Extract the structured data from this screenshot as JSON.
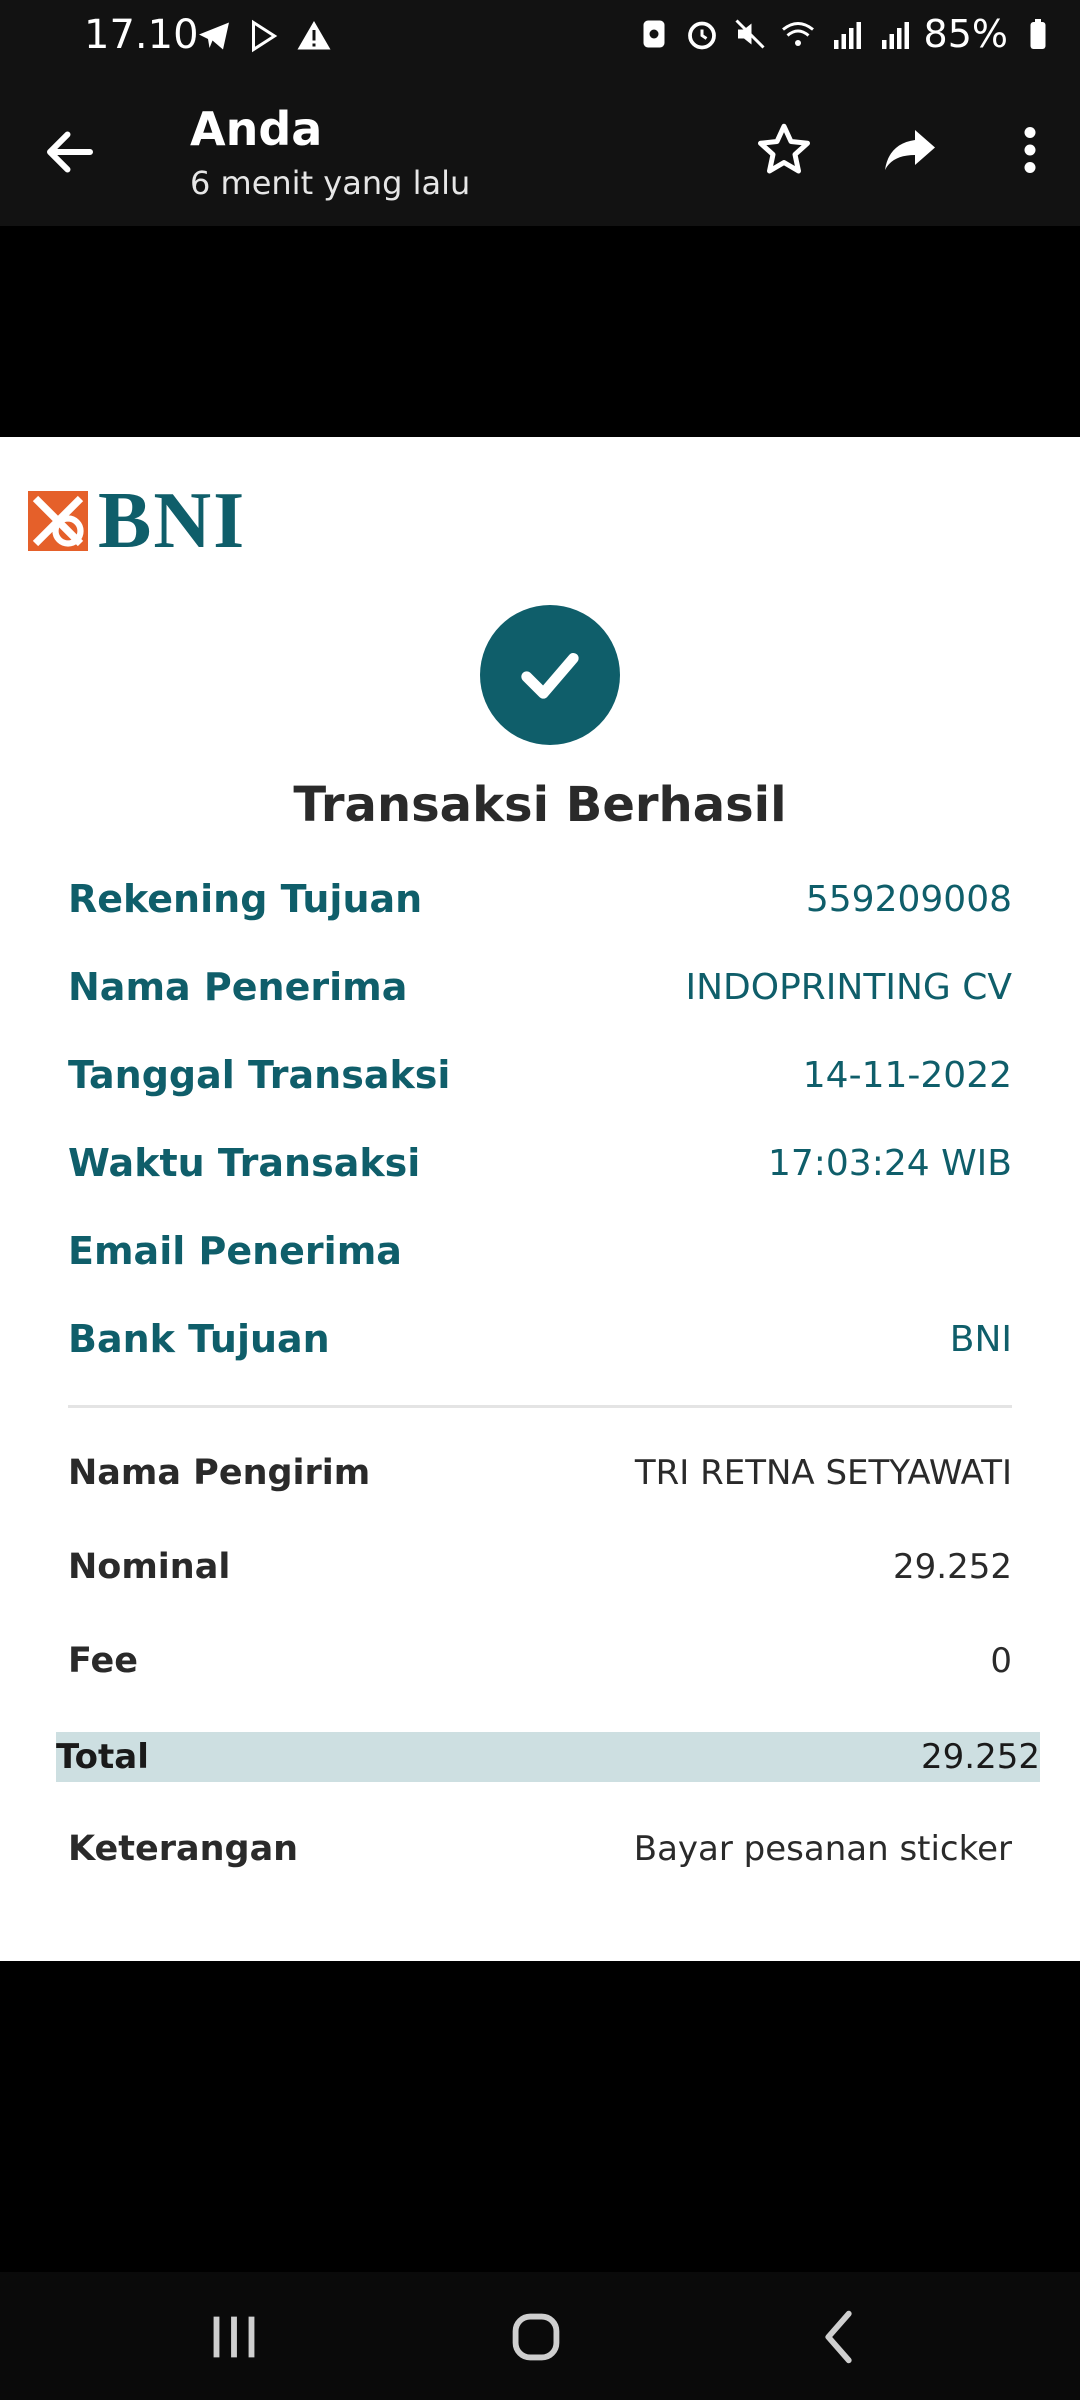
{
  "status_bar": {
    "time": "17.10",
    "battery": "85%"
  },
  "app_bar": {
    "title": "Anda",
    "subtitle": "6 menit yang lalu"
  },
  "receipt": {
    "bank_logo": "BNI",
    "title": "Transaksi Berhasil",
    "fields": [
      {
        "label": "Rekening Tujuan",
        "value": "559209008"
      },
      {
        "label": "Nama Penerima",
        "value": "INDOPRINTING CV"
      },
      {
        "label": "Tanggal Transaksi",
        "value": "14-11-2022"
      },
      {
        "label": "Waktu Transaksi",
        "value": "17:03:24 WIB"
      },
      {
        "label": "Email Penerima",
        "value": ""
      },
      {
        "label": "Bank Tujuan",
        "value": "BNI"
      }
    ],
    "details": [
      {
        "label": "Nama Pengirim",
        "value": "TRI RETNA SETYAWATI"
      },
      {
        "label": "Nominal",
        "value": "29.252"
      },
      {
        "label": "Fee",
        "value": "0"
      }
    ],
    "total": {
      "label": "Total",
      "value": "29.252"
    },
    "note": {
      "label": "Keterangan",
      "value": "Bayar pesanan sticker"
    }
  },
  "colors": {
    "brand_teal": "#0f5e6a",
    "brand_orange": "#e5602a",
    "total_bg": "#cddfe1"
  }
}
